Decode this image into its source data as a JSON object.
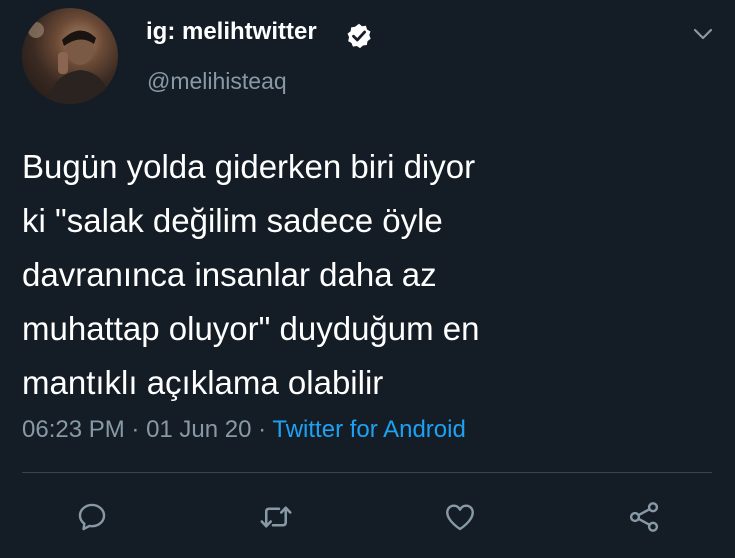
{
  "tweet": {
    "author": {
      "display_name": "ig: melihtwitter",
      "handle": "@melihisteaq",
      "verified": true,
      "avatar_icon": "profile-photo"
    },
    "text": "Bugün yolda giderken biri diyor\nki \"salak değilim sadece öyle\ndavranınca insanlar daha az\nmuhattap oluyor\" duyduğum en\nmantıklı açıklama olabilir",
    "time": "06:23 PM",
    "separator": " · ",
    "date": "01 Jun 20",
    "source": "Twitter for Android"
  },
  "actions": [
    {
      "icon": "reply-icon"
    },
    {
      "icon": "retweet-icon"
    },
    {
      "icon": "like-icon"
    },
    {
      "icon": "share-icon"
    }
  ],
  "colors": {
    "background": "#141d26",
    "text": "#ffffff",
    "secondary": "#8899a6",
    "accent": "#1da1f2",
    "divider": "#38444d"
  }
}
